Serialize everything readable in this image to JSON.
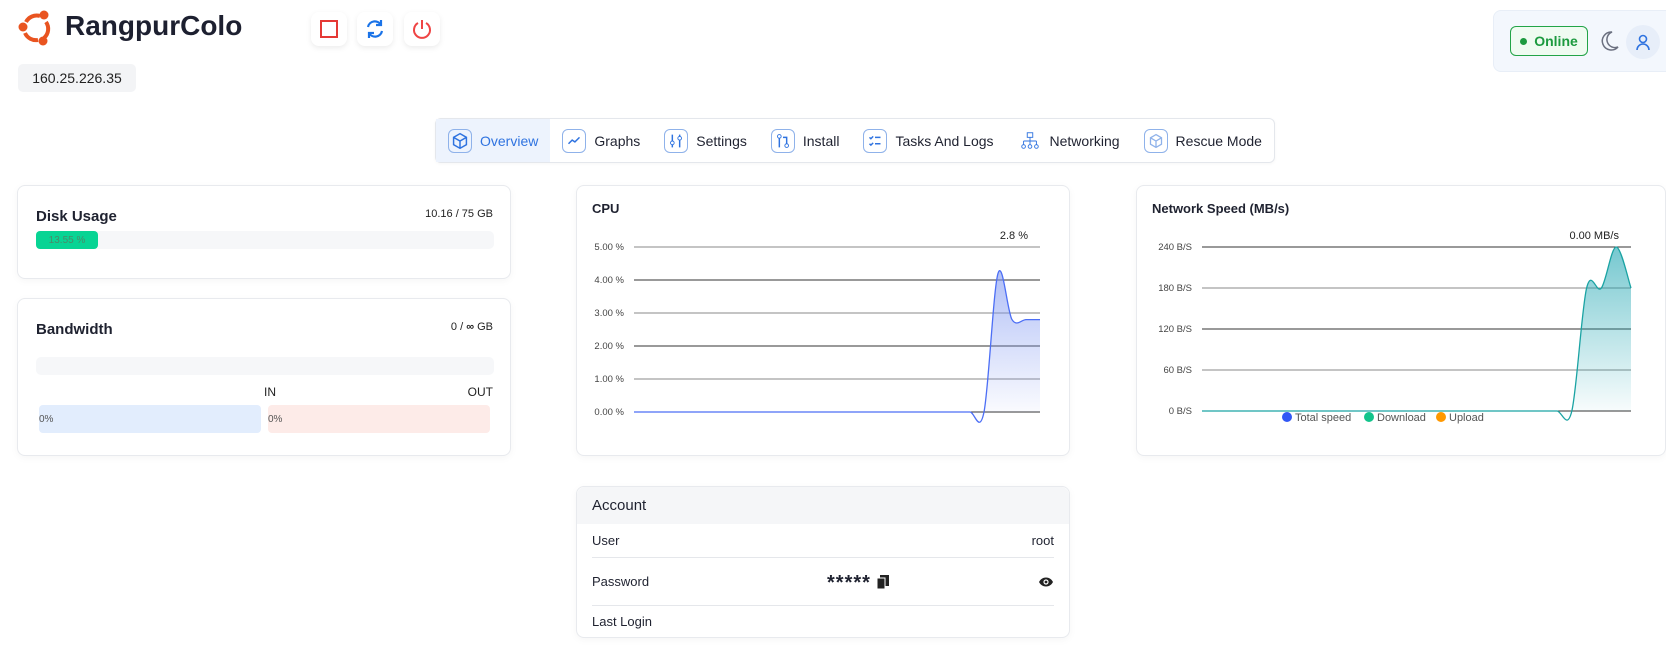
{
  "header": {
    "brand": "RangpurColo",
    "ip": "160.25.226.35",
    "status": "Online",
    "buttons": [
      {
        "icon": "stop-icon",
        "color": "#e53935"
      },
      {
        "icon": "refresh-icon",
        "color": "#1a73e8"
      },
      {
        "icon": "power-icon",
        "color": "#ef4444"
      }
    ]
  },
  "nav": {
    "tabs": [
      {
        "label": "Overview",
        "icon": "cube-icon",
        "active": true
      },
      {
        "label": "Graphs",
        "icon": "chart-line-icon"
      },
      {
        "label": "Settings",
        "icon": "sliders-icon"
      },
      {
        "label": "Install",
        "icon": "git-pull-icon"
      },
      {
        "label": "Tasks And Logs",
        "icon": "checklist-icon"
      },
      {
        "label": "Networking",
        "icon": "sitemap-icon"
      },
      {
        "label": "Rescue Mode",
        "icon": "cube-outline-icon"
      }
    ]
  },
  "disk": {
    "title": "Disk Usage",
    "usage": "10.16 / 75 GB",
    "percent_label": "13.55 %",
    "percent": 13.55,
    "color": "#08d494"
  },
  "bandwidth": {
    "title": "Bandwidth",
    "usage_prefix": "0 /",
    "usage_suffix": "GB",
    "in_label": "IN",
    "out_label": "OUT",
    "in_value": "0%",
    "out_value": "0%",
    "percent": 0
  },
  "account": {
    "title": "Account",
    "rows": [
      {
        "label": "User",
        "value": "root"
      },
      {
        "label": "Password",
        "value": "*****"
      },
      {
        "label": "Last Login",
        "value": ""
      }
    ]
  },
  "chart_data": [
    {
      "type": "area",
      "title": "CPU",
      "current_label": "2.8 %",
      "ylim": [
        0,
        5
      ],
      "yticks": [
        "0.00 %",
        "1.00 %",
        "2.00 %",
        "3.00 %",
        "4.00 %",
        "5.00 %"
      ],
      "grid": true,
      "color": "#4c6ef5",
      "values": [
        0,
        0,
        0,
        0,
        0,
        0,
        0,
        0,
        0,
        0,
        0,
        0,
        0,
        0,
        0,
        0,
        0,
        0,
        0,
        0,
        0,
        0,
        0,
        0,
        0,
        0,
        4.2,
        2.8,
        2.8,
        2.8
      ]
    },
    {
      "type": "area",
      "title": "Network Speed (MB/s)",
      "current_label": "0.00 MB/s",
      "ylim": [
        0,
        240
      ],
      "yticks": [
        "0 B/S",
        "60 B/S",
        "120 B/S",
        "180 B/S",
        "240 B/S"
      ],
      "grid": true,
      "legend": "bottom",
      "series": [
        {
          "name": "Total speed",
          "color": "#3157f5",
          "values": []
        },
        {
          "name": "Download",
          "color": "#12c48b",
          "values": [
            0,
            0,
            0,
            0,
            0,
            0,
            0,
            0,
            0,
            0,
            0,
            0,
            0,
            0,
            0,
            0,
            0,
            0,
            0,
            0,
            0,
            0,
            0,
            0,
            0,
            0,
            180,
            180,
            240,
            180
          ]
        },
        {
          "name": "Upload",
          "color": "#ff9800",
          "values": []
        }
      ],
      "line_color": "#1aa3a3"
    }
  ]
}
